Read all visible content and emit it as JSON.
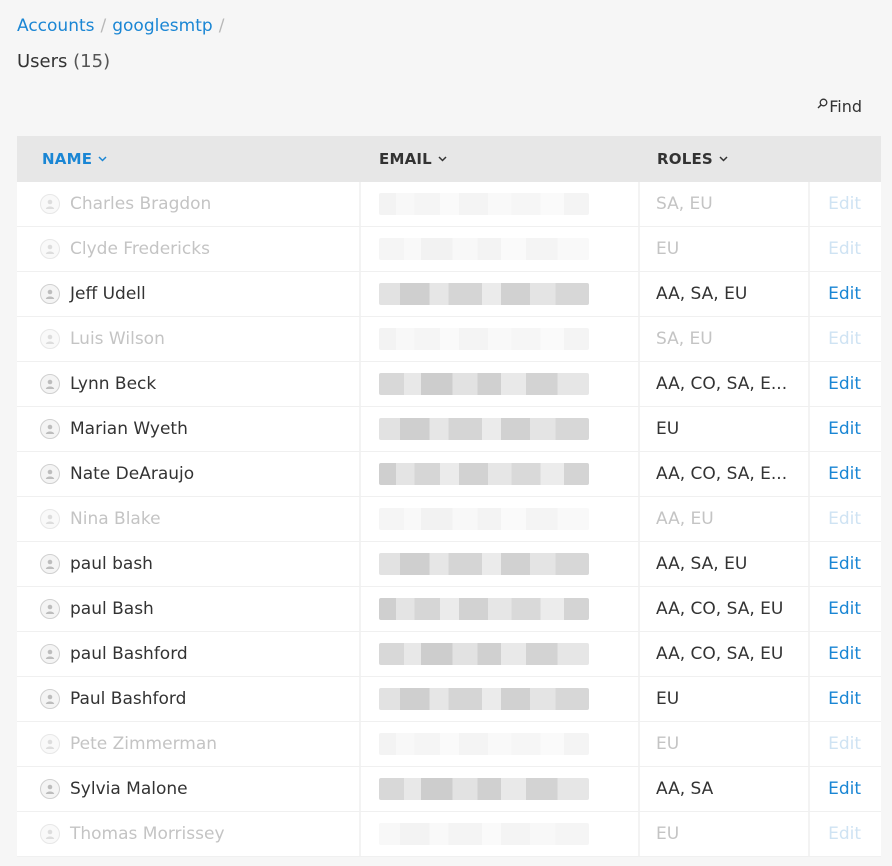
{
  "breadcrumb": {
    "accounts": "Accounts",
    "account": "googlesmtp",
    "separator": "/"
  },
  "page": {
    "title": "Users",
    "count": "(15)"
  },
  "find": {
    "label": "Find",
    "icon": "search-icon"
  },
  "table": {
    "columns": {
      "name": "NAME",
      "email": "EMAIL",
      "roles": "ROLES"
    },
    "sort_icon": "chevron-down-icon",
    "edit_label": "Edit",
    "rows": [
      {
        "name": "Charles Bragdon",
        "roles": "SA, EU",
        "active": false
      },
      {
        "name": "Clyde Fredericks",
        "roles": "EU",
        "active": false
      },
      {
        "name": "Jeff Udell",
        "roles": "AA, SA, EU",
        "active": true
      },
      {
        "name": "Luis Wilson",
        "roles": "SA, EU",
        "active": false
      },
      {
        "name": "Lynn Beck",
        "roles": "AA, CO, SA, E...",
        "active": true
      },
      {
        "name": "Marian Wyeth",
        "roles": "EU",
        "active": true
      },
      {
        "name": "Nate DeAraujo",
        "roles": "AA, CO, SA, E...",
        "active": true
      },
      {
        "name": "Nina Blake",
        "roles": "AA, EU",
        "active": false
      },
      {
        "name": "paul bash",
        "roles": "AA, SA, EU",
        "active": true
      },
      {
        "name": "paul Bash",
        "roles": "AA, CO, SA, EU",
        "active": true
      },
      {
        "name": "paul Bashford",
        "roles": "AA, CO, SA, EU",
        "active": true
      },
      {
        "name": "Paul Bashford",
        "roles": "EU",
        "active": true
      },
      {
        "name": "Pete Zimmerman",
        "roles": "EU",
        "active": false
      },
      {
        "name": "Sylvia Malone",
        "roles": "AA, SA",
        "active": true
      },
      {
        "name": "Thomas Morrissey",
        "roles": "EU",
        "active": false
      }
    ]
  },
  "colors": {
    "link": "#1a86d4",
    "disabled_text": "#c4c4c4",
    "header_bg": "#e7e7e7"
  }
}
